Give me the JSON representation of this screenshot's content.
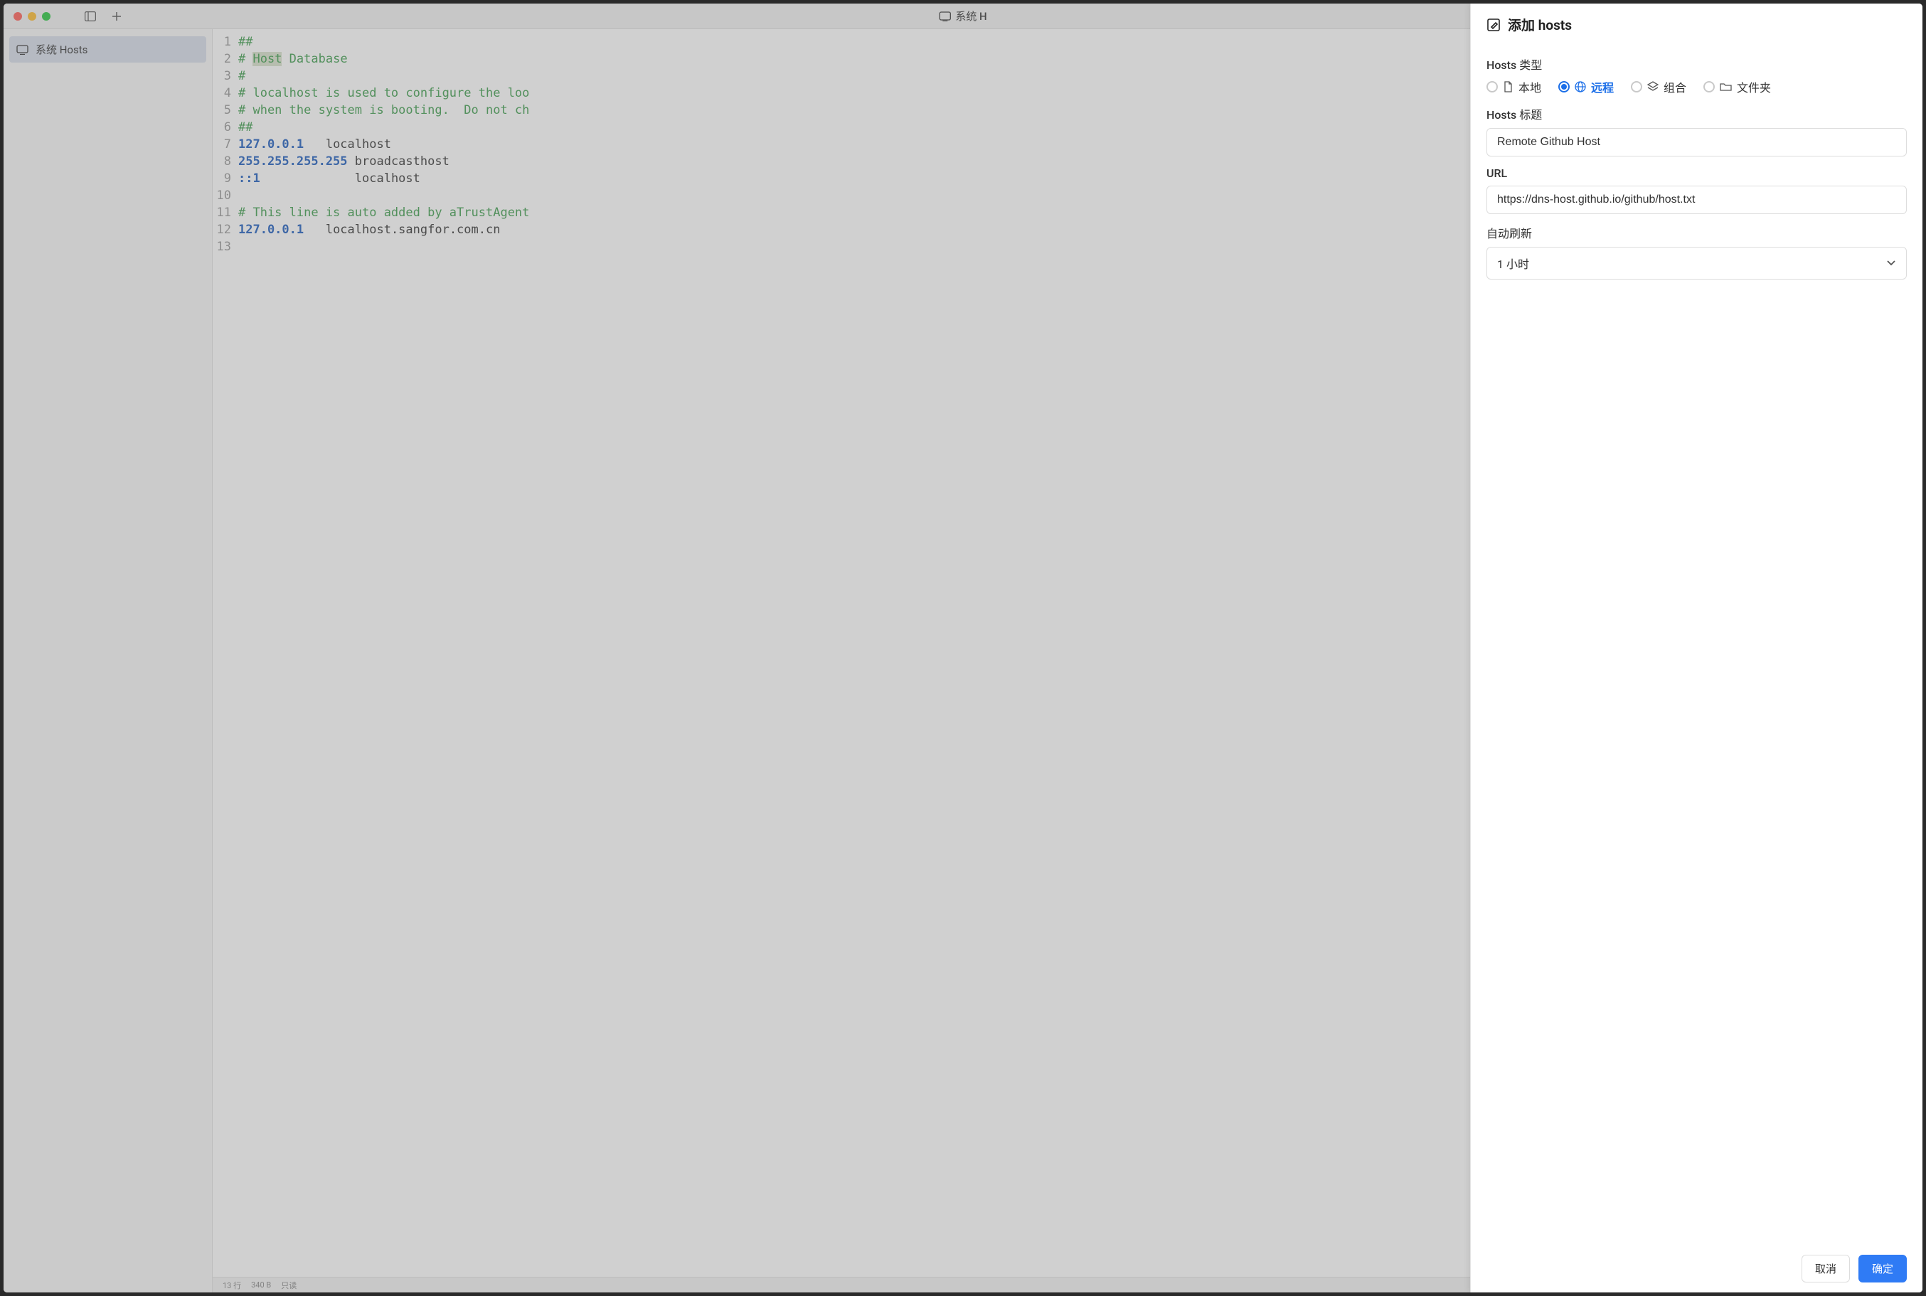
{
  "titlebar": {
    "title": "系统 H"
  },
  "sidebar": {
    "item_label": "系统 Hosts"
  },
  "statusbar": {
    "lines": "13 行",
    "size": "340 B",
    "readonly": "只读"
  },
  "editor": {
    "lines": [
      {
        "n": "1",
        "cls": "c-comment",
        "t": "##"
      },
      {
        "n": "2",
        "cls": "c-comment",
        "t": "# ",
        "extra": "Host",
        "t2": " Database"
      },
      {
        "n": "3",
        "cls": "c-comment",
        "t": "#"
      },
      {
        "n": "4",
        "cls": "c-comment",
        "t": "# localhost is used to configure the loo"
      },
      {
        "n": "5",
        "cls": "c-comment",
        "t": "# when the system is booting.  Do not ch"
      },
      {
        "n": "6",
        "cls": "c-comment",
        "t": "##"
      },
      {
        "n": "7",
        "cls": "c-ip",
        "t": "127.0.0.1",
        "rest": "   localhost"
      },
      {
        "n": "8",
        "cls": "c-ip",
        "t": "255.255.255.255",
        "rest": " broadcasthost"
      },
      {
        "n": "9",
        "cls": "c-ip",
        "t": "::1",
        "rest": "             localhost"
      },
      {
        "n": "10",
        "cls": "",
        "t": ""
      },
      {
        "n": "11",
        "cls": "c-comment",
        "t": "# This line is auto added by aTrustAgent"
      },
      {
        "n": "12",
        "cls": "c-ip",
        "t": "127.0.0.1",
        "rest": "   localhost.sangfor.com.cn"
      },
      {
        "n": "13",
        "cls": "",
        "t": ""
      }
    ]
  },
  "panel": {
    "title": "添加 hosts",
    "type_label": "Hosts 类型",
    "options": {
      "local": "本地",
      "remote": "远程",
      "group": "组合",
      "folder": "文件夹"
    },
    "title_field_label": "Hosts 标题",
    "title_field_value": "Remote Github Host",
    "url_label": "URL",
    "url_value": "https://dns-host.github.io/github/host.txt",
    "refresh_label": "自动刷新",
    "refresh_value": "1 小时",
    "cancel": "取消",
    "ok": "确定"
  }
}
